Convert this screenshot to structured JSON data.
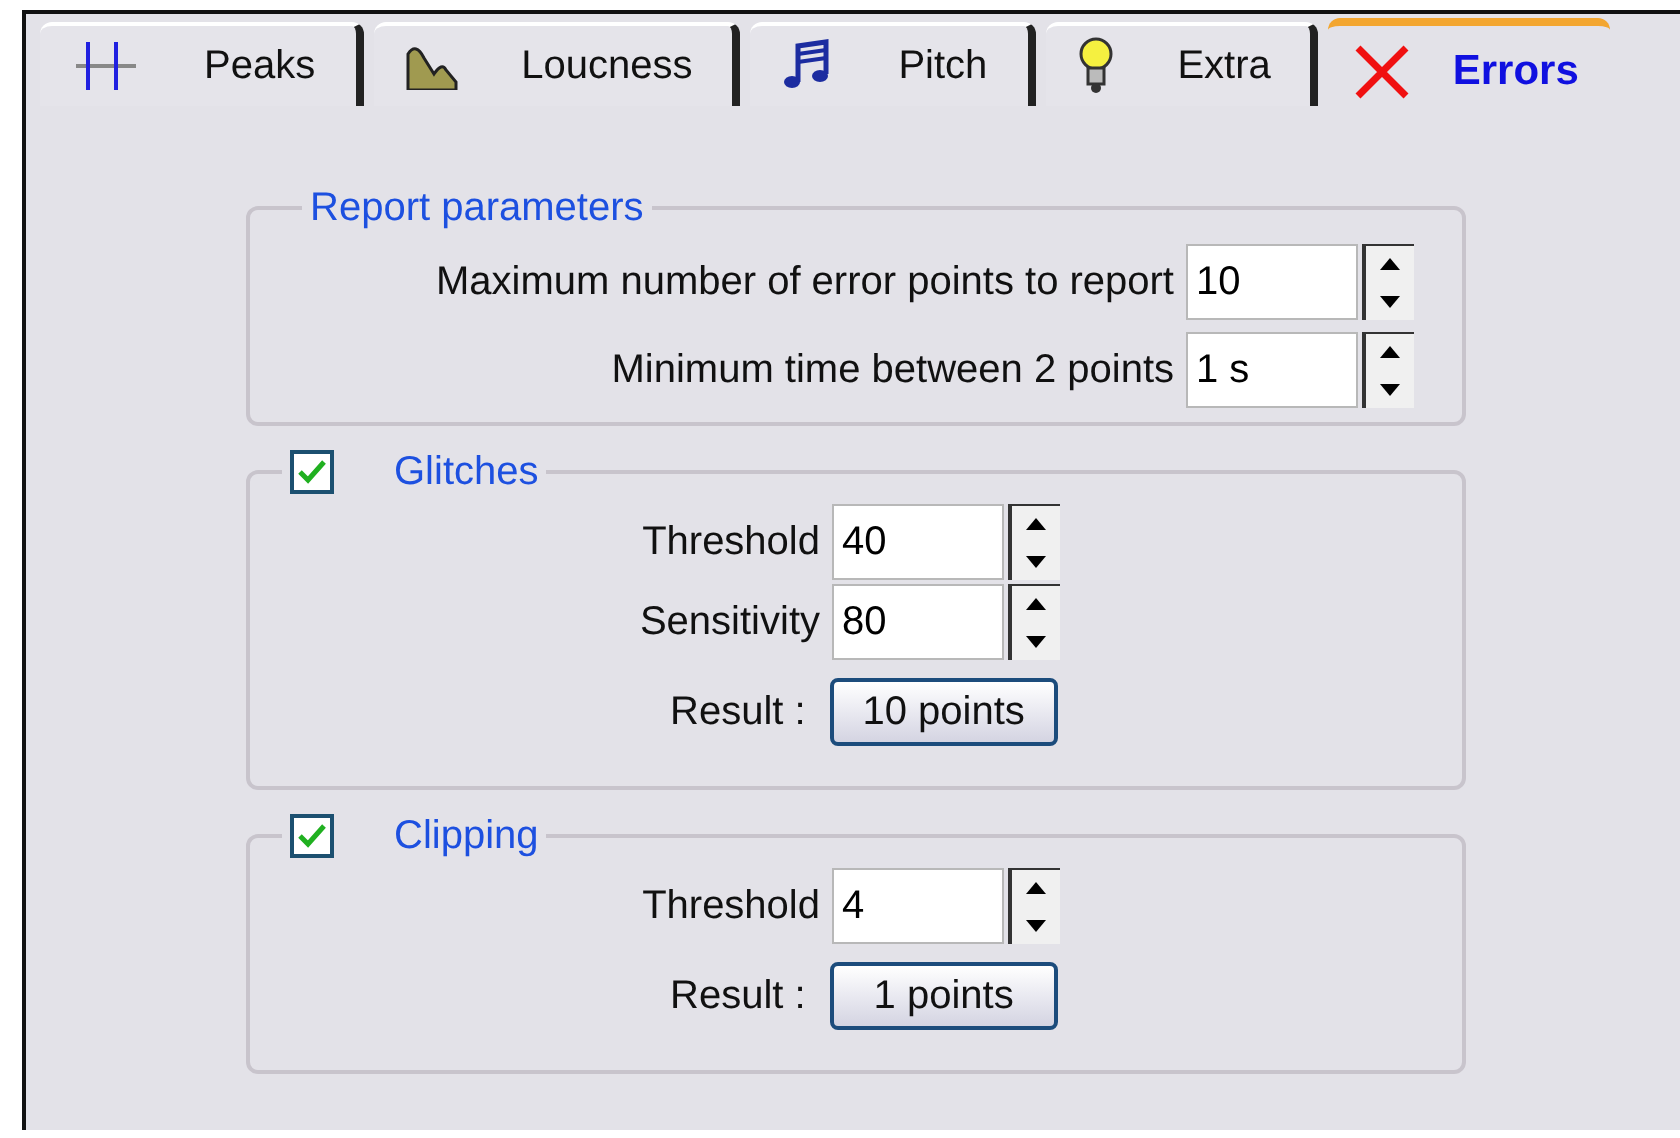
{
  "tabs": [
    {
      "label": "Peaks",
      "selected": false
    },
    {
      "label": "Loucness",
      "selected": false
    },
    {
      "label": "Pitch",
      "selected": false
    },
    {
      "label": "Extra",
      "selected": false
    },
    {
      "label": "Errors",
      "selected": true
    }
  ],
  "report": {
    "title": "Report parameters",
    "fields": [
      {
        "label": "Maximum number of error points to report",
        "value": "10"
      },
      {
        "label": "Minimum time between 2 points",
        "value": "1 s"
      }
    ]
  },
  "groups": [
    {
      "title": "Glitches",
      "checked": true,
      "fields": [
        {
          "label": "Threshold",
          "value": "40"
        },
        {
          "label": "Sensitivity",
          "value": "80"
        }
      ],
      "result_label": "Result :",
      "result": "10 points"
    },
    {
      "title": "Clipping",
      "checked": true,
      "fields": [
        {
          "label": "Threshold",
          "value": "4"
        }
      ],
      "result_label": "Result :",
      "result": "1 points"
    }
  ]
}
